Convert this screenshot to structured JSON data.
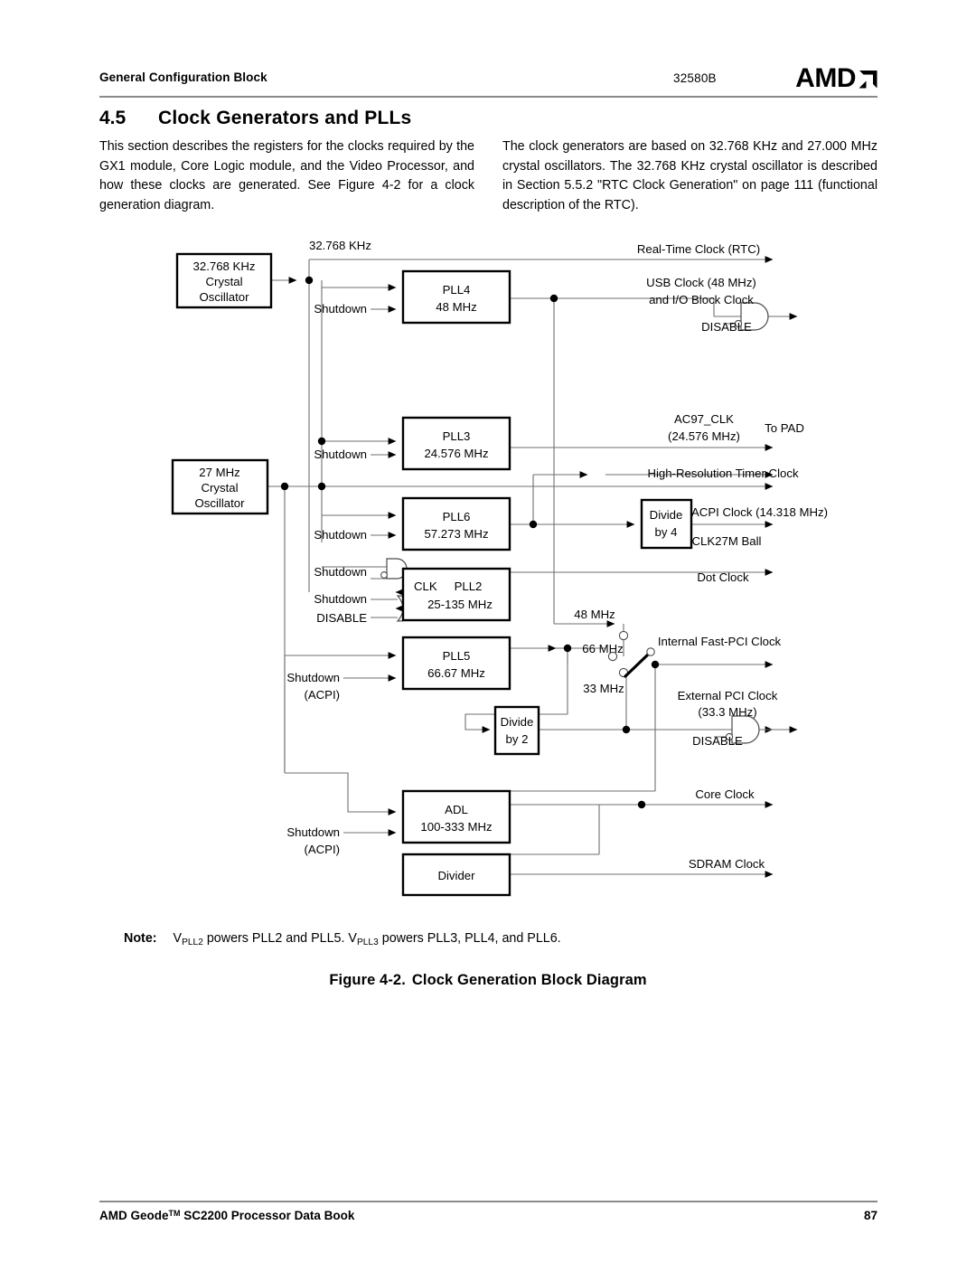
{
  "header": {
    "left_title": "General Configuration Block",
    "doc_number": "32580B",
    "logo_text": "AMD"
  },
  "section": {
    "number": "4.5",
    "title": "Clock Generators and PLLs"
  },
  "body": {
    "left_paragraph": "This section describes the registers for the clocks required by the GX1 module, Core Logic module, and the Video Processor, and how these clocks are generated. See Figure 4-2 for a clock generation diagram.",
    "right_paragraph": "The clock generators are based on 32.768 KHz and 27.000 MHz crystal oscillators. The 32.768 KHz crystal oscillator is described in Section 5.5.2 \"RTC Clock Generation\" on page 111 (functional description of the RTC)."
  },
  "note": {
    "label": "Note:",
    "text_a": "V",
    "sub_a": "PLL2",
    "text_b": " powers PLL2 and PLL5. V",
    "sub_b": "PLL3",
    "text_c": " powers PLL3, PLL4, and PLL6."
  },
  "caption": {
    "figure": "Figure 4-2.",
    "title": "Clock Generation Block Diagram"
  },
  "footer": {
    "book_a": "AMD Geode",
    "book_tm": "TM",
    "book_b": " SC2200  Processor Data Book",
    "page": "87"
  },
  "diagram": {
    "oscillators": [
      {
        "id": "osc-32k",
        "line1": "32.768 KHz",
        "line2": "Crystal",
        "line3": "Oscillator"
      },
      {
        "id": "osc-27m",
        "line1": "27 MHz",
        "line2": "Crystal",
        "line3": "Oscillator"
      }
    ],
    "blocks": [
      {
        "id": "pll4",
        "line1": "PLL4",
        "line2": "48 MHz"
      },
      {
        "id": "pll3",
        "line1": "PLL3",
        "line2": "24.576 MHz"
      },
      {
        "id": "pll6",
        "line1": "PLL6",
        "line2": "57.273 MHz"
      },
      {
        "id": "pll2",
        "prefix": "CLK",
        "line1": "PLL2",
        "line2": "25-135 MHz"
      },
      {
        "id": "pll5",
        "line1": "PLL5",
        "line2": "66.67 MHz"
      },
      {
        "id": "adl",
        "line1": "ADL",
        "line2": "100-333 MHz"
      },
      {
        "id": "divider",
        "line1": "Divider"
      },
      {
        "id": "divide-by-4",
        "line1": "Divide",
        "line2": "by 4"
      },
      {
        "id": "divide-by-2",
        "line1": "Divide",
        "line2": "by 2"
      }
    ],
    "input_labels": [
      {
        "id": "src-32768",
        "text": "32.768 KHz"
      },
      {
        "id": "shutdown-pll4",
        "text": "Shutdown"
      },
      {
        "id": "shutdown-pll3",
        "text": "Shutdown"
      },
      {
        "id": "shutdown-pll6",
        "text": "Shutdown"
      },
      {
        "id": "shutdown-gate-and",
        "text": "Shutdown"
      },
      {
        "id": "shutdown-gate-or",
        "text": "Shutdown"
      },
      {
        "id": "disable-pll2",
        "text": "DISABLE"
      },
      {
        "id": "shutdown-pll5",
        "text": "Shutdown"
      },
      {
        "id": "shutdown-pll5-acpi",
        "text": "(ACPI)"
      },
      {
        "id": "shutdown-adl",
        "text": "Shutdown"
      },
      {
        "id": "shutdown-adl-acpi",
        "text": "(ACPI)"
      }
    ],
    "output_labels": [
      {
        "id": "rtc",
        "text": "Real-Time Clock (RTC)"
      },
      {
        "id": "usb-1",
        "text": "USB Clock (48 MHz)"
      },
      {
        "id": "usb-2",
        "text": "and I/O Block Clock"
      },
      {
        "id": "usb-disable",
        "text": "DISABLE"
      },
      {
        "id": "ac97-1",
        "text": "AC97_CLK"
      },
      {
        "id": "ac97-2",
        "text": "(24.576 MHz)"
      },
      {
        "id": "to-pad",
        "text": "To PAD"
      },
      {
        "id": "hrt",
        "text": "High-Resolution Timer Clock"
      },
      {
        "id": "acpi-clock",
        "text": "ACPI Clock (14.318 MHz)"
      },
      {
        "id": "clk27m",
        "text": "CLK27M Ball"
      },
      {
        "id": "dot-clock",
        "text": "Dot Clock"
      },
      {
        "id": "mux-48",
        "text": "48 MHz"
      },
      {
        "id": "mux-66",
        "text": "66 MHz"
      },
      {
        "id": "mux-33",
        "text": "33 MHz"
      },
      {
        "id": "fast-pci",
        "text": "Internal Fast-PCI Clock"
      },
      {
        "id": "ext-pci-1",
        "text": "External PCI Clock"
      },
      {
        "id": "ext-pci-2",
        "text": "(33.3 MHz)"
      },
      {
        "id": "ext-pci-disable",
        "text": "DISABLE"
      },
      {
        "id": "core-clock",
        "text": "Core Clock"
      },
      {
        "id": "sdram-clock",
        "text": "SDRAM Clock"
      }
    ]
  }
}
